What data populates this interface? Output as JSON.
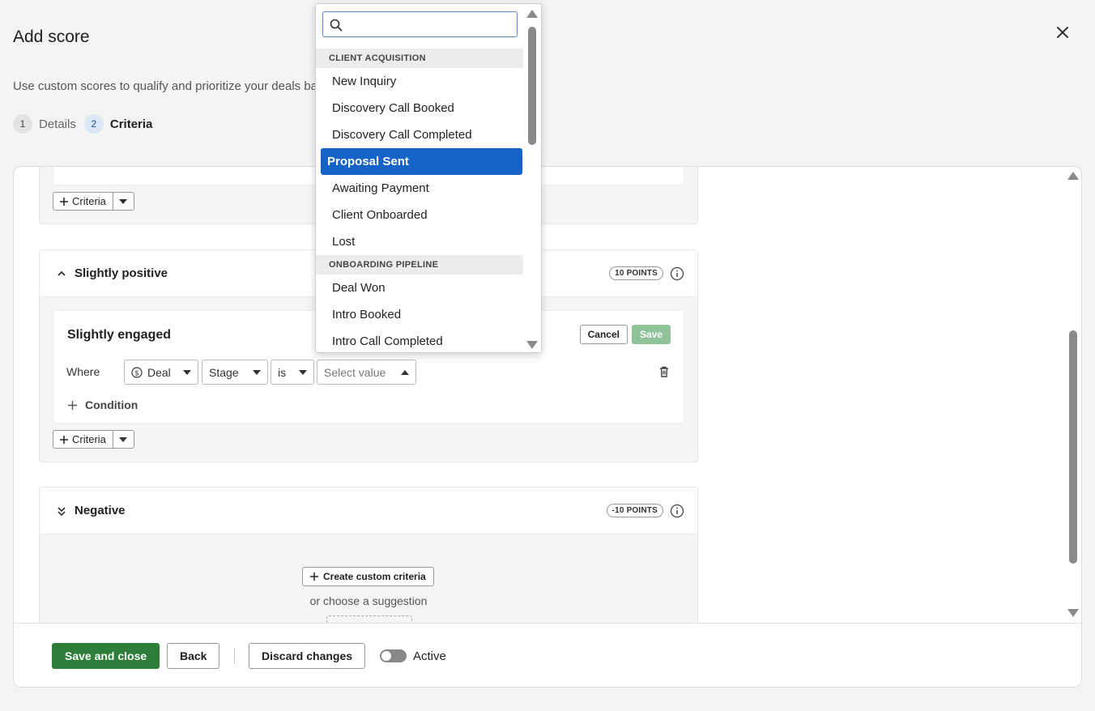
{
  "modal": {
    "title": "Add score",
    "description": "Use custom scores to qualify and prioritize your deals ba",
    "close_icon": "close-icon"
  },
  "steps": [
    {
      "num": "1",
      "label": "Details",
      "state": "done"
    },
    {
      "num": "2",
      "label": "Criteria",
      "state": "current"
    }
  ],
  "top_section": {
    "criteria_button": "Criteria"
  },
  "slightly_positive": {
    "name": "Slightly positive",
    "points": "10 POINTS",
    "criteria": {
      "title": "Slightly engaged",
      "cancel": "Cancel",
      "save": "Save",
      "where": "Where",
      "object": "Deal",
      "field": "Stage",
      "operator": "is",
      "value_placeholder": "Select value",
      "add_condition": "Condition"
    },
    "criteria_button": "Criteria"
  },
  "negative": {
    "name": "Negative",
    "points": "-10 POINTS",
    "create_custom": "Create custom criteria",
    "or_choose": "or choose a suggestion"
  },
  "footer": {
    "save_close": "Save and close",
    "back": "Back",
    "discard": "Discard changes",
    "active_label": "Active",
    "active": false
  },
  "dropdown": {
    "search_value": "",
    "groups": [
      {
        "label": "CLIENT ACQUISITION",
        "items": [
          "New Inquiry",
          "Discovery Call Booked",
          "Discovery Call Completed",
          "Proposal Sent",
          "Awaiting Payment",
          "Client Onboarded",
          "Lost"
        ]
      },
      {
        "label": "ONBOARDING PIPELINE",
        "items": [
          "Deal Won",
          "Intro Booked",
          "Intro Call Completed"
        ]
      }
    ],
    "selected": "Proposal Sent"
  },
  "colors": {
    "primary_green": "#2f7d3b",
    "save_disabled": "#8fc49a",
    "selected_blue": "#1663c7"
  }
}
